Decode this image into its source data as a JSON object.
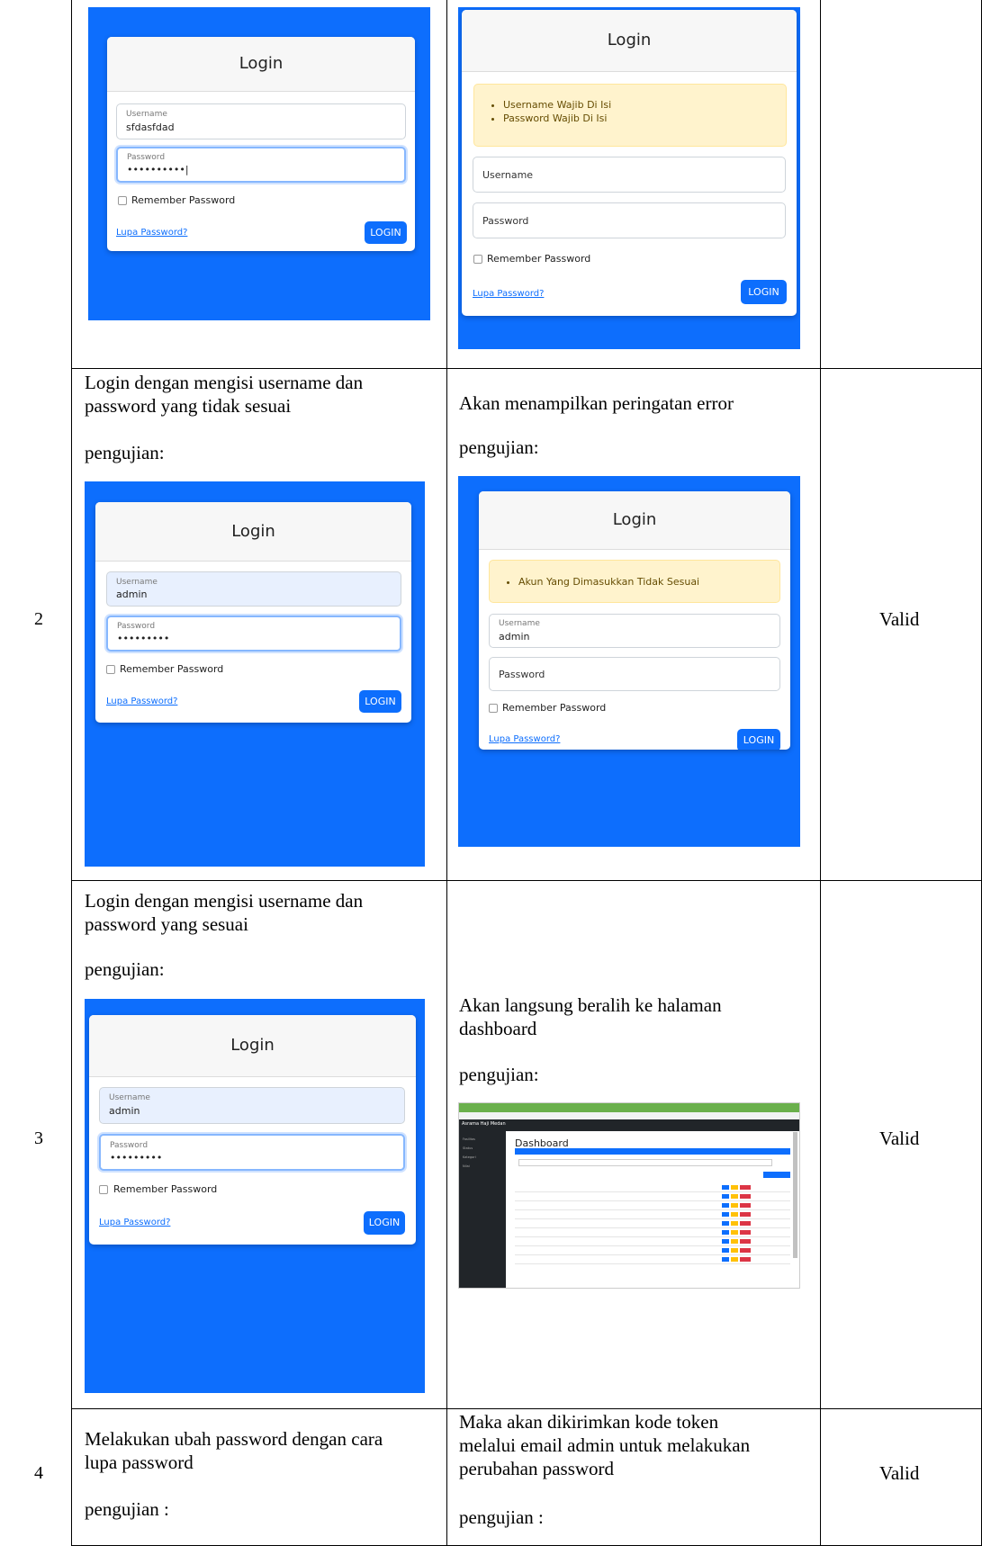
{
  "rows": [
    {
      "number": "",
      "scenario_lines": [],
      "expected_lines": [],
      "result": ""
    },
    {
      "number": "2",
      "scenario_lines": [
        "Login dengan mengisi username dan",
        "password yang tidak sesuai"
      ],
      "scenario_label": "pengujian:",
      "expected_lines": [
        "Akan menampilkan peringatan error"
      ],
      "expected_label": "pengujian:",
      "result": "Valid"
    },
    {
      "number": "3",
      "scenario_lines": [
        "Login dengan mengisi username dan",
        "password yang sesuai"
      ],
      "scenario_label": "pengujian:",
      "expected_lines": [
        "Akan langsung beralih ke halaman",
        "dashboard"
      ],
      "expected_label": "pengujian:",
      "result": "Valid"
    },
    {
      "number": "4",
      "scenario_lines": [
        "Melakukan ubah password dengan cara",
        "lupa password"
      ],
      "scenario_label": "pengujian :",
      "expected_lines": [
        "Maka akan dikirimkan kode token",
        "melalui email admin untuk melakukan",
        "perubahan password"
      ],
      "expected_label": "pengujian :",
      "result": "Valid"
    }
  ],
  "login": {
    "title": "Login",
    "username_label": "Username",
    "password_label": "Password",
    "remember_label": "Remember Password",
    "forgot_link": "Lupa Password?",
    "login_button": "LOGIN"
  },
  "shots": {
    "r1_left": {
      "username_value": "sfdasfdad",
      "password_value": "••••••••••|"
    },
    "r1_right": {
      "alerts": [
        "Username Wajib Di Isi",
        "Password Wajib Di Isi"
      ]
    },
    "r2_left": {
      "username_value": "admin",
      "password_value": "•••••••••"
    },
    "r2_right": {
      "alerts": [
        "Akun Yang Dimasukkan Tidak Sesuai"
      ],
      "username_value": "admin"
    },
    "r3_left": {
      "username_value": "admin",
      "password_value": "•••••••••"
    }
  },
  "dashboard": {
    "brand": "Asrama Haji Medan",
    "title": "Dashboard",
    "sidebar_items": [
      "Fasilitas",
      "Status",
      "Kategori",
      "Nilai"
    ],
    "row_count": 9
  }
}
